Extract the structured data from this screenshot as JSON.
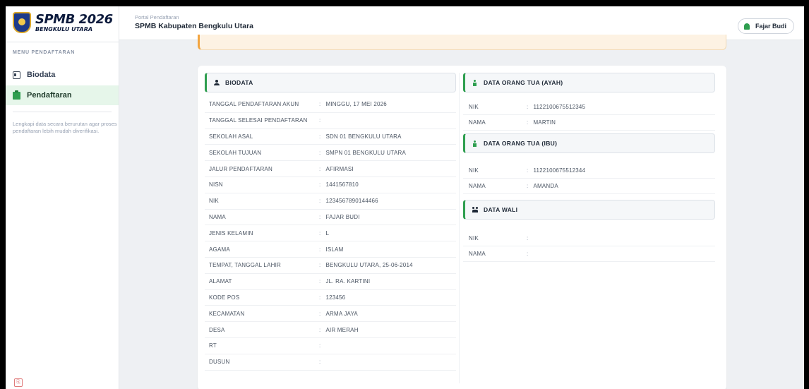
{
  "brand": {
    "title": "SPMB 2026",
    "subtitle": "BENGKULU UTARA",
    "accent": "#2e9e4f"
  },
  "sidebar": {
    "heading": "MENU PENDAFTARAN",
    "items": [
      {
        "label": "Biodata",
        "icon": "id-card-icon",
        "active": false
      },
      {
        "label": "Pendaftaran",
        "icon": "clipboard-icon",
        "active": true
      }
    ],
    "help": "Lengkapi data secara berurutan agar proses pendaftaran lebih mudah diverifikasi."
  },
  "header": {
    "portal_label": "Portal Pendaftaran",
    "title": "SPMB Kabupaten Bengkulu Utara",
    "user": "Fajar Budi"
  },
  "biodata": {
    "title": "BIODATA",
    "rows": [
      {
        "label": "TANGGAL PENDAFTARAN AKUN",
        "value": "MINGGU, 17 MEI 2026"
      },
      {
        "label": "TANGGAL SELESAI PENDAFTARAN",
        "value": ""
      },
      {
        "label": "SEKOLAH ASAL",
        "value": "SDN 01 BENGKULU UTARA"
      },
      {
        "label": "SEKOLAH TUJUAN",
        "value": "SMPN 01 BENGKULU UTARA"
      },
      {
        "label": "JALUR PENDAFTARAN",
        "value": "AFIRMASI"
      },
      {
        "label": "NISN",
        "value": "1441567810"
      },
      {
        "label": "NIK",
        "value": "1234567890144466"
      },
      {
        "label": "NAMA",
        "value": "FAJAR BUDI"
      },
      {
        "label": "JENIS KELAMIN",
        "value": "L"
      },
      {
        "label": "AGAMA",
        "value": "ISLAM"
      },
      {
        "label": "TEMPAT, TANGGAL LAHIR",
        "value": "BENGKULU UTARA, 25-06-2014"
      },
      {
        "label": "ALAMAT",
        "value": "JL. RA. KARTINI"
      },
      {
        "label": "KODE POS",
        "value": "123456"
      },
      {
        "label": "KECAMATAN",
        "value": "ARMA JAYA"
      },
      {
        "label": "DESA",
        "value": "AIR MERAH"
      },
      {
        "label": "RT",
        "value": ""
      },
      {
        "label": "DUSUN",
        "value": ""
      }
    ]
  },
  "ayah": {
    "title": "DATA ORANG TUA (AYAH)",
    "rows": [
      {
        "label": "NIK",
        "value": "1122100675512345"
      },
      {
        "label": "NAMA",
        "value": "MARTIN"
      }
    ]
  },
  "ibu": {
    "title": "DATA ORANG TUA (IBU)",
    "rows": [
      {
        "label": "NIK",
        "value": "1122100675512344"
      },
      {
        "label": "NAMA",
        "value": "AMANDA"
      }
    ]
  },
  "wali": {
    "title": "DATA WALI",
    "rows": [
      {
        "label": "NIK",
        "value": ""
      },
      {
        "label": "NAMA",
        "value": ""
      }
    ]
  }
}
